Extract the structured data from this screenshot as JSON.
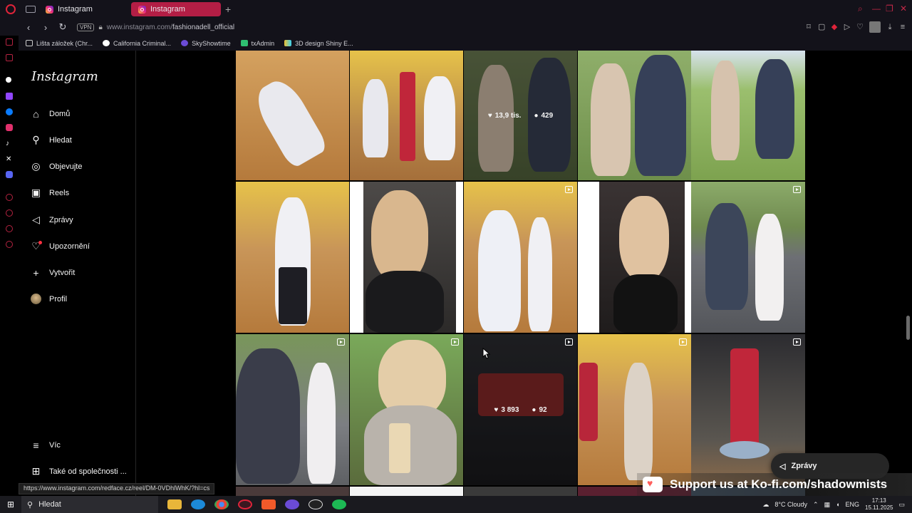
{
  "browser": {
    "tabs": [
      {
        "label": "Instagram",
        "active": false
      },
      {
        "label": "Instagram",
        "active": true
      }
    ],
    "new_tab_label": "+",
    "url_host": "www.instagram.com/",
    "url_path": "fashionadell_official",
    "vpn_label": "VPN",
    "bookmarks": [
      {
        "label": "Lišta záložek (Chr...",
        "icon": "folder-icon"
      },
      {
        "label": "California Criminal...",
        "icon": "globe-icon"
      },
      {
        "label": "SkyShowtime",
        "icon": "sky-icon"
      },
      {
        "label": "txAdmin",
        "icon": "tx-icon"
      },
      {
        "label": "3D design Shiny E...",
        "icon": "grid-icon"
      }
    ],
    "status_url": "https://www.instagram.com/redface.cz/reel/DM-0VDhlWhK/?hl=cs"
  },
  "sidebar": {
    "logo": "Instagram",
    "items": [
      {
        "label": "Domů",
        "icon": "home-icon"
      },
      {
        "label": "Hledat",
        "icon": "search-icon"
      },
      {
        "label": "Objevujte",
        "icon": "compass-icon"
      },
      {
        "label": "Reels",
        "icon": "reels-icon"
      },
      {
        "label": "Zprávy",
        "icon": "messenger-icon"
      },
      {
        "label": "Upozornění",
        "icon": "heart-icon"
      },
      {
        "label": "Vytvořit",
        "icon": "plus-icon"
      },
      {
        "label": "Profil",
        "icon": "profile-avatar"
      }
    ],
    "more": "Víc",
    "meta": "Také od společnosti ..."
  },
  "grid": {
    "hover_1": {
      "likes": "13,9 tis.",
      "comments": "429"
    },
    "hover_2": {
      "likes": "3 893",
      "comments": "92"
    }
  },
  "messages_pill": "Zprávy",
  "kofi": "Support us at Ko-fi.com/shadowmists",
  "taskbar": {
    "search_placeholder": "Hledat",
    "weather": "8°C  Cloudy",
    "lang": "ENG",
    "time": "17:13",
    "date": "15.11.2025"
  }
}
